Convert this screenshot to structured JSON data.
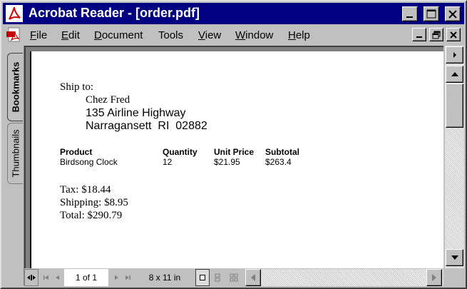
{
  "window": {
    "title": "Acrobat Reader - [order.pdf]"
  },
  "menu": {
    "items": [
      {
        "label": "File",
        "u": "F",
        "rest": "ile"
      },
      {
        "label": "Edit",
        "u": "E",
        "rest": "dit"
      },
      {
        "label": "Document",
        "u": "D",
        "rest": "ocument"
      },
      {
        "label": "Tools",
        "u": "",
        "rest": "Tools"
      },
      {
        "label": "View",
        "u": "V",
        "rest": "iew"
      },
      {
        "label": "Window",
        "u": "W",
        "rest": "indow"
      },
      {
        "label": "Help",
        "u": "H",
        "rest": "elp"
      }
    ]
  },
  "sidetabs": {
    "bookmarks": "Bookmarks",
    "thumbnails": "Thumbnails"
  },
  "document": {
    "ship_to_label": "Ship to:",
    "name": "Chez Fred",
    "address1": "135 Airline Highway",
    "address2": "Narragansett  RI  02882",
    "columns": [
      "Product",
      "Quantity",
      "Unit Price",
      "Subtotal"
    ],
    "row": [
      "Birdsong Clock",
      "12",
      "$21.95",
      "$263.4"
    ],
    "tax": "Tax: $18.44",
    "shipping": "Shipping: $8.95",
    "total": "Total: $290.79"
  },
  "status": {
    "page": "1 of 1",
    "page_size": "8 x 11 in"
  },
  "colors": {
    "titlebar": "#000080",
    "chrome": "#c0c0c0",
    "page": "#ffffff"
  },
  "icons": [
    "acrobat-logo-icon",
    "pdf-document-icon",
    "minimize-icon",
    "maximize-icon",
    "close-icon",
    "restore-icon",
    "scroll-up-icon",
    "scroll-down-icon",
    "scroll-right-icon",
    "next-page-icon",
    "first-page-icon",
    "prev-page-icon",
    "last-page-icon",
    "single-page-icon",
    "continuous-page-icon",
    "facing-pages-icon",
    "split-toggle-icon"
  ]
}
